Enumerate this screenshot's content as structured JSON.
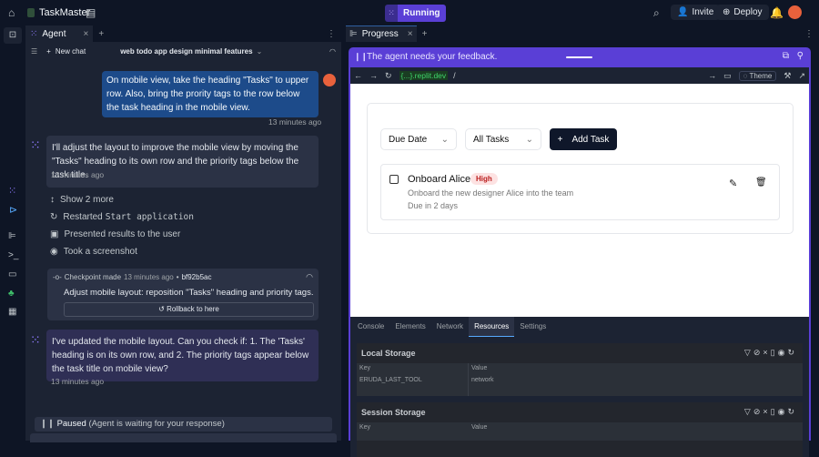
{
  "topbar": {
    "app_name": "TaskMaster",
    "run_status": "Running",
    "invite": "Invite",
    "deploy": "Deploy"
  },
  "agent_panel": {
    "tab_label": "Agent",
    "new_chat": "New chat",
    "chat_title": "web todo app design minimal features",
    "messages": [
      {
        "role": "user",
        "text": "On mobile view, take the heading \"Tasks\" to upper row. Also, bring the prority tags to the row below the task heading in the mobile view.",
        "time": "13 minutes ago"
      },
      {
        "role": "agent",
        "text": "I'll adjust the layout to improve the mobile view by moving the \"Tasks\" heading to its own row and the priority tags below the task title.",
        "time": "13 minutes ago"
      },
      {
        "role": "agent",
        "text": "I've updated the mobile layout. Can you check if: 1. The 'Tasks' heading is on its own row, and 2. The priority tags appear below the task title on mobile view?",
        "time": "13 minutes ago"
      }
    ],
    "actions": {
      "show_more": "Show 2 more",
      "restarted_prefix": "Restarted",
      "restarted_code": "Start application",
      "presented": "Presented results to the user",
      "screenshot": "Took a screenshot"
    },
    "checkpoint": {
      "label": "Checkpoint made",
      "time": "13 minutes ago",
      "hash": "bf92b5ac",
      "desc": "Adjust mobile layout: reposition \"Tasks\" heading and priority tags.",
      "rollback": "Rollback to here"
    },
    "paused": {
      "label": "Paused",
      "detail": "(Agent is waiting for your response)"
    }
  },
  "progress_panel": {
    "tab_label": "Progress",
    "banner": "The agent needs your feedback.",
    "url_domain": "{...}.replit.dev",
    "url_path": "/",
    "theme": "Theme",
    "app": {
      "sort_select": "Due Date",
      "filter_select": "All Tasks",
      "add_task": "Add Task",
      "task": {
        "title": "Onboard Alice",
        "priority": "High",
        "description": "Onboard the new designer Alice into the team",
        "due": "Due in 2 days"
      }
    },
    "devtools": {
      "tabs": [
        "Console",
        "Elements",
        "Network",
        "Resources",
        "Settings"
      ],
      "active_tab": "Resources",
      "local_storage": {
        "title": "Local Storage",
        "key_header": "Key",
        "value_header": "Value",
        "rows": [
          {
            "key": "ERUDA_LAST_TOOL",
            "value": "network"
          }
        ]
      },
      "session_storage": {
        "title": "Session Storage",
        "key_header": "Key",
        "value_header": "Value"
      }
    }
  }
}
